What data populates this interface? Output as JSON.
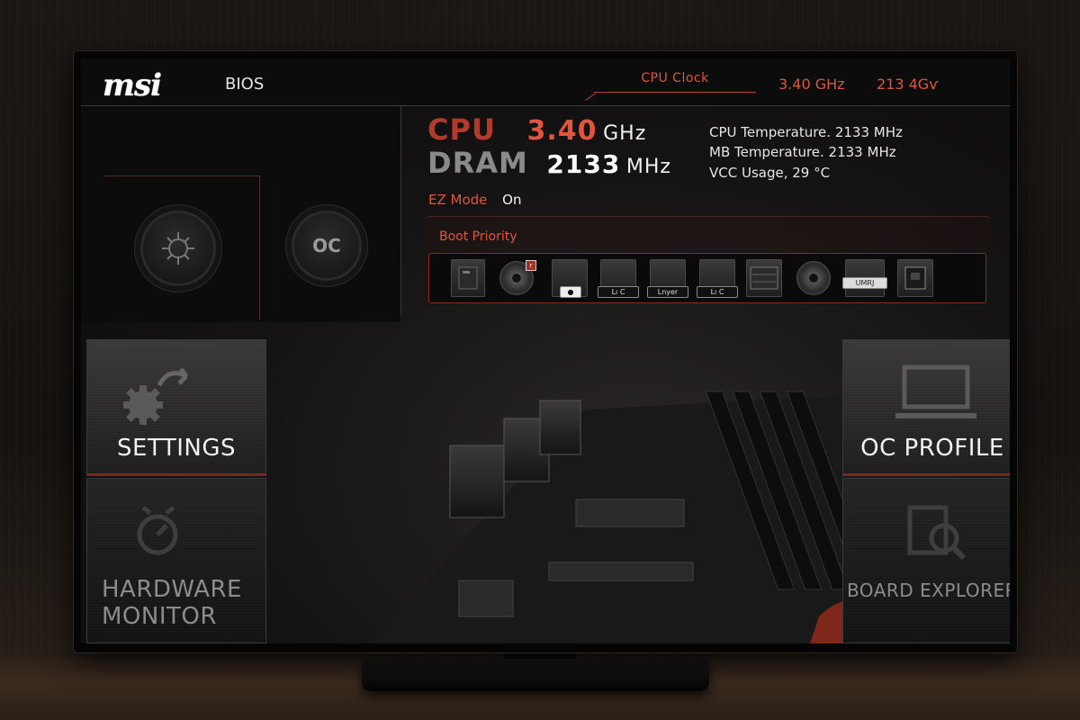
{
  "header": {
    "logo": "msi",
    "bios_label": "BIOS",
    "clock_tab": "CPU Clock",
    "clock_value": "3.40 GHz",
    "second_value": "213 4Gѵ"
  },
  "cpu_info": {
    "cpu_label": "CPU",
    "cpu_value": "3.40",
    "cpu_unit": "GHz",
    "dram_label": "DRAM",
    "dram_value": "2133",
    "dram_unit": "MHz"
  },
  "stats": [
    "CPU Temperature. 2133 MHz",
    "MB Temperature. 2133 MHz",
    "VCC Usage, 29 °C"
  ],
  "ez_mode": {
    "label": "EZ Mode",
    "value": "On"
  },
  "mode_icons": {
    "left": "game-boost-icon",
    "right_text": "OC"
  },
  "boot": {
    "title": "Boot Priority",
    "devices": [
      {
        "icon": "drive-icon",
        "label": ""
      },
      {
        "icon": "disc-icon",
        "label": "",
        "badge": "r"
      },
      {
        "icon": "drive-icon",
        "label": "●"
      },
      {
        "icon": "usb-drive-icon",
        "label": "Lı C"
      },
      {
        "icon": "usb-drive-icon",
        "label": "Lnyer"
      },
      {
        "icon": "usb-drive-icon",
        "label": "Lı C"
      },
      {
        "icon": "network-icon",
        "label": ""
      },
      {
        "icon": "disc-icon",
        "label": ""
      },
      {
        "icon": "usb-key-icon",
        "label": "UMRJ"
      },
      {
        "icon": "card-reader-icon",
        "label": ""
      }
    ]
  },
  "tiles": {
    "settings": "SETTINGS",
    "hardware_monitor": [
      "HARDWARE",
      "MONITOR"
    ],
    "oc_profile": "OC PROFILE",
    "board_explorer": "BOARD EXPLORER"
  },
  "colors": {
    "accent": "#e0553c",
    "accent_dark": "#b33a2a",
    "panel": "#0c0c0c"
  }
}
